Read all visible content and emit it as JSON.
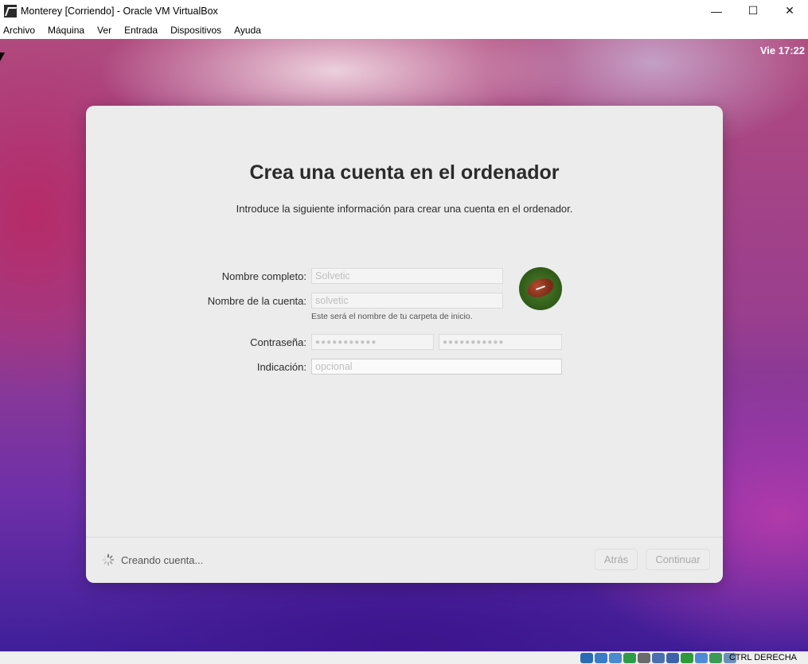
{
  "window": {
    "title": "Monterey [Corriendo] - Oracle VM VirtualBox",
    "controls": {
      "minimize": "—",
      "maximize": "☐",
      "close": "✕"
    }
  },
  "menu": [
    "Archivo",
    "Máquina",
    "Ver",
    "Entrada",
    "Dispositivos",
    "Ayuda"
  ],
  "desktop": {
    "clock": "Vie 17:22"
  },
  "dialog": {
    "title": "Crea una cuenta en el ordenador",
    "subtitle": "Introduce la siguiente información para crear una cuenta en el ordenador.",
    "fields": {
      "full_name": {
        "label": "Nombre completo:",
        "value": "Solvetic"
      },
      "account_name": {
        "label": "Nombre de la cuenta:",
        "value": "solvetic",
        "help": "Este será el nombre de tu carpeta de inicio."
      },
      "password": {
        "label": "Contraseña:",
        "value": "●●●●●●●●●●●",
        "verify": "●●●●●●●●●●●"
      },
      "hint": {
        "label": "Indicación:",
        "placeholder": "opcional"
      }
    },
    "avatar": {
      "icon": "football-avatar-icon"
    },
    "status": "Creando cuenta...",
    "buttons": {
      "back": "Atrás",
      "continue": "Continuar"
    }
  },
  "statusbar": {
    "host_key": "CTRL DERECHA",
    "icons": [
      "hdd-icon",
      "optical-icon",
      "audio-icon",
      "network-icon",
      "usb-icon",
      "shared-folder-icon",
      "display-icon",
      "recording-icon",
      "cpu-icon",
      "mouse-icon",
      "keyboard-icon"
    ],
    "icon_colors": [
      "#2b6bb5",
      "#3a7bc8",
      "#4a8ad0",
      "#2d9b4a",
      "#6b6b6b",
      "#4a6fb0",
      "#3d62a8",
      "#2f9a3c",
      "#4e8ad8",
      "#3c9a56",
      "#6b8fb8"
    ]
  }
}
